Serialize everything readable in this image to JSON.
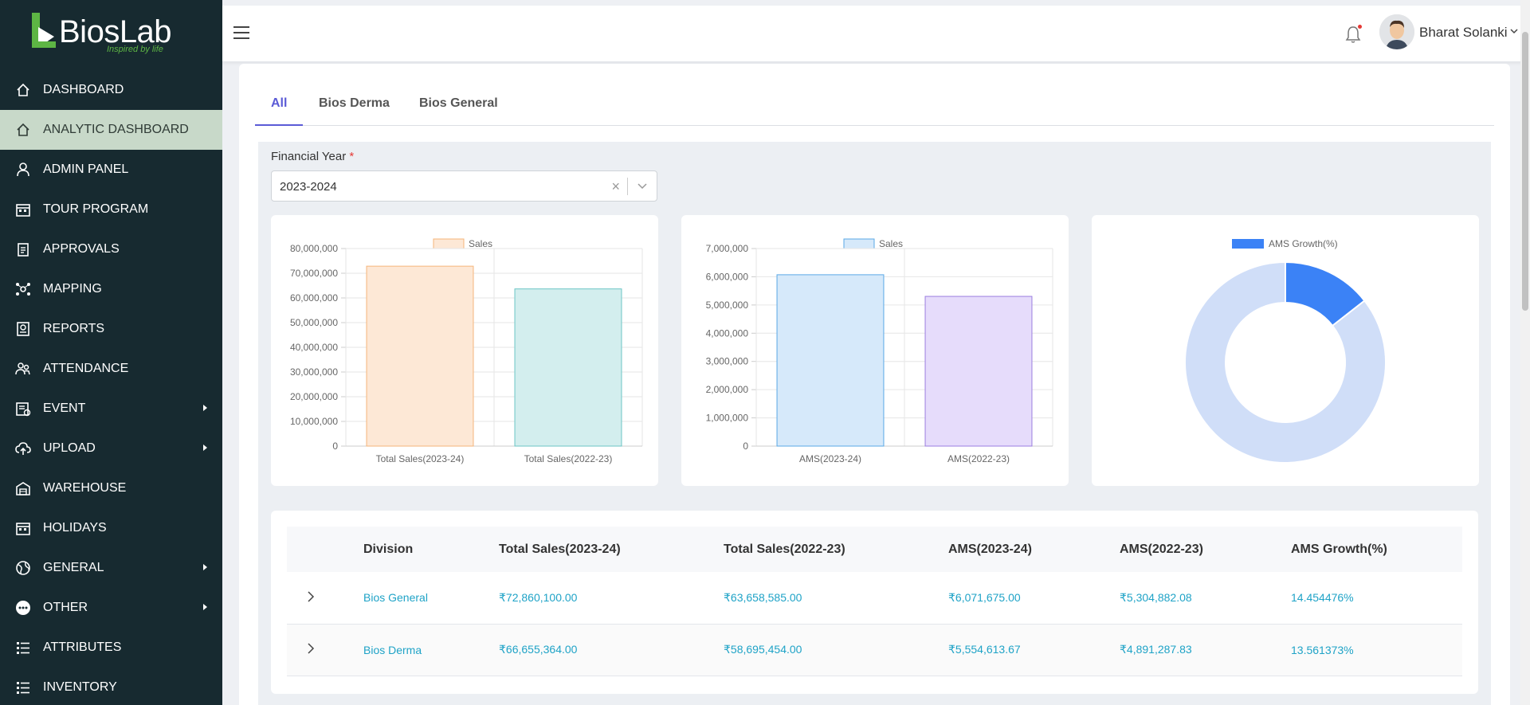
{
  "app": {
    "logo_text": "BiosLab",
    "logo_tagline": "Inspired by life"
  },
  "sidebar": {
    "items": [
      {
        "label": "DASHBOARD",
        "icon": "home-icon",
        "active": false,
        "has_submenu": false
      },
      {
        "label": "ANALYTIC DASHBOARD",
        "icon": "home-icon",
        "active": true,
        "has_submenu": false
      },
      {
        "label": "ADMIN PANEL",
        "icon": "user-icon",
        "active": false,
        "has_submenu": false
      },
      {
        "label": "TOUR PROGRAM",
        "icon": "calendar-icon",
        "active": false,
        "has_submenu": false
      },
      {
        "label": "APPROVALS",
        "icon": "clipboard-icon",
        "active": false,
        "has_submenu": false
      },
      {
        "label": "MAPPING",
        "icon": "network-icon",
        "active": false,
        "has_submenu": false
      },
      {
        "label": "REPORTS",
        "icon": "report-icon",
        "active": false,
        "has_submenu": false
      },
      {
        "label": "ATTENDANCE",
        "icon": "people-icon",
        "active": false,
        "has_submenu": false
      },
      {
        "label": "EVENT",
        "icon": "event-icon",
        "active": false,
        "has_submenu": true
      },
      {
        "label": "UPLOAD",
        "icon": "cloud-upload-icon",
        "active": false,
        "has_submenu": true
      },
      {
        "label": "WAREHOUSE",
        "icon": "warehouse-icon",
        "active": false,
        "has_submenu": false
      },
      {
        "label": "HOLIDAYS",
        "icon": "calendar-icon",
        "active": false,
        "has_submenu": false
      },
      {
        "label": "GENERAL",
        "icon": "globe-icon",
        "active": false,
        "has_submenu": true
      },
      {
        "label": "OTHER",
        "icon": "more-circle-icon",
        "active": false,
        "has_submenu": true
      },
      {
        "label": "ATTRIBUTES",
        "icon": "list-icon",
        "active": false,
        "has_submenu": false
      },
      {
        "label": "INVENTORY",
        "icon": "list-icon",
        "active": false,
        "has_submenu": false
      }
    ]
  },
  "header": {
    "user_name": "Bharat Solanki"
  },
  "tabs": [
    {
      "label": "All",
      "active": true
    },
    {
      "label": "Bios Derma",
      "active": false
    },
    {
      "label": "Bios General",
      "active": false
    }
  ],
  "filter": {
    "label": "Financial Year",
    "required_mark": "*",
    "value": "2023-2024"
  },
  "chart_data": [
    {
      "type": "bar",
      "categories": [
        "Total Sales(2023-24)",
        "Total Sales(2022-23)"
      ],
      "series": [
        {
          "name": "Sales",
          "values": [
            72860100,
            63658585
          ]
        }
      ],
      "ylim": [
        0,
        80000000
      ],
      "yticks": [
        "0",
        "10,000,000",
        "20,000,000",
        "30,000,000",
        "40,000,000",
        "50,000,000",
        "60,000,000",
        "70,000,000",
        "80,000,000"
      ],
      "colors": [
        "#fde8d6",
        "#d3eeee"
      ],
      "border_colors": [
        "#f5b57a",
        "#6cc6c6"
      ],
      "legend_color": "#fde8d6",
      "legend_border": "#f5b57a",
      "grid": true,
      "legend": "top"
    },
    {
      "type": "bar",
      "categories": [
        "AMS(2023-24)",
        "AMS(2022-23)"
      ],
      "series": [
        {
          "name": "Sales",
          "values": [
            6071675.0,
            5304882.08
          ]
        }
      ],
      "ylim": [
        0,
        7000000
      ],
      "yticks": [
        "0",
        "1,000,000",
        "2,000,000",
        "3,000,000",
        "4,000,000",
        "5,000,000",
        "6,000,000",
        "7,000,000"
      ],
      "colors": [
        "#d6e9fa",
        "#e6dcfb"
      ],
      "border_colors": [
        "#5aa8e6",
        "#9b7ee0"
      ],
      "legend_color": "#d6e9fa",
      "legend_border": "#5aa8e6",
      "grid": true,
      "legend": "top"
    },
    {
      "type": "pie",
      "series": [
        {
          "name": "AMS Growth(%)",
          "values": [
            14.454476,
            85.545524
          ]
        }
      ],
      "colors": [
        "#3b82f6",
        "#d0def8"
      ],
      "legend_color": "#3b82f6",
      "legend": "top"
    }
  ],
  "table": {
    "headers": [
      "Division",
      "Total Sales(2023-24)",
      "Total Sales(2022-23)",
      "AMS(2023-24)",
      "AMS(2022-23)",
      "AMS Growth(%)"
    ],
    "rows": [
      [
        "Bios General",
        "₹72,860,100.00",
        "₹63,658,585.00",
        "₹6,071,675.00",
        "₹5,304,882.08",
        "14.454476%"
      ],
      [
        "Bios Derma",
        "₹66,655,364.00",
        "₹58,695,454.00",
        "₹5,554,613.67",
        "₹4,891,287.83",
        "13.561373%"
      ]
    ]
  }
}
